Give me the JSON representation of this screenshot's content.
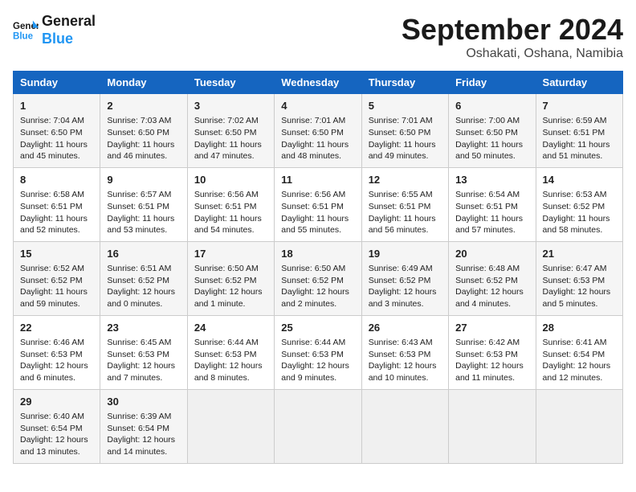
{
  "header": {
    "logo_line1": "General",
    "logo_line2": "Blue",
    "month": "September 2024",
    "location": "Oshakati, Oshana, Namibia"
  },
  "weekdays": [
    "Sunday",
    "Monday",
    "Tuesday",
    "Wednesday",
    "Thursday",
    "Friday",
    "Saturday"
  ],
  "weeks": [
    [
      {
        "day": "1",
        "sunrise": "Sunrise: 7:04 AM",
        "sunset": "Sunset: 6:50 PM",
        "daylight": "Daylight: 11 hours and 45 minutes."
      },
      {
        "day": "2",
        "sunrise": "Sunrise: 7:03 AM",
        "sunset": "Sunset: 6:50 PM",
        "daylight": "Daylight: 11 hours and 46 minutes."
      },
      {
        "day": "3",
        "sunrise": "Sunrise: 7:02 AM",
        "sunset": "Sunset: 6:50 PM",
        "daylight": "Daylight: 11 hours and 47 minutes."
      },
      {
        "day": "4",
        "sunrise": "Sunrise: 7:01 AM",
        "sunset": "Sunset: 6:50 PM",
        "daylight": "Daylight: 11 hours and 48 minutes."
      },
      {
        "day": "5",
        "sunrise": "Sunrise: 7:01 AM",
        "sunset": "Sunset: 6:50 PM",
        "daylight": "Daylight: 11 hours and 49 minutes."
      },
      {
        "day": "6",
        "sunrise": "Sunrise: 7:00 AM",
        "sunset": "Sunset: 6:50 PM",
        "daylight": "Daylight: 11 hours and 50 minutes."
      },
      {
        "day": "7",
        "sunrise": "Sunrise: 6:59 AM",
        "sunset": "Sunset: 6:51 PM",
        "daylight": "Daylight: 11 hours and 51 minutes."
      }
    ],
    [
      {
        "day": "8",
        "sunrise": "Sunrise: 6:58 AM",
        "sunset": "Sunset: 6:51 PM",
        "daylight": "Daylight: 11 hours and 52 minutes."
      },
      {
        "day": "9",
        "sunrise": "Sunrise: 6:57 AM",
        "sunset": "Sunset: 6:51 PM",
        "daylight": "Daylight: 11 hours and 53 minutes."
      },
      {
        "day": "10",
        "sunrise": "Sunrise: 6:56 AM",
        "sunset": "Sunset: 6:51 PM",
        "daylight": "Daylight: 11 hours and 54 minutes."
      },
      {
        "day": "11",
        "sunrise": "Sunrise: 6:56 AM",
        "sunset": "Sunset: 6:51 PM",
        "daylight": "Daylight: 11 hours and 55 minutes."
      },
      {
        "day": "12",
        "sunrise": "Sunrise: 6:55 AM",
        "sunset": "Sunset: 6:51 PM",
        "daylight": "Daylight: 11 hours and 56 minutes."
      },
      {
        "day": "13",
        "sunrise": "Sunrise: 6:54 AM",
        "sunset": "Sunset: 6:51 PM",
        "daylight": "Daylight: 11 hours and 57 minutes."
      },
      {
        "day": "14",
        "sunrise": "Sunrise: 6:53 AM",
        "sunset": "Sunset: 6:52 PM",
        "daylight": "Daylight: 11 hours and 58 minutes."
      }
    ],
    [
      {
        "day": "15",
        "sunrise": "Sunrise: 6:52 AM",
        "sunset": "Sunset: 6:52 PM",
        "daylight": "Daylight: 11 hours and 59 minutes."
      },
      {
        "day": "16",
        "sunrise": "Sunrise: 6:51 AM",
        "sunset": "Sunset: 6:52 PM",
        "daylight": "Daylight: 12 hours and 0 minutes."
      },
      {
        "day": "17",
        "sunrise": "Sunrise: 6:50 AM",
        "sunset": "Sunset: 6:52 PM",
        "daylight": "Daylight: 12 hours and 1 minute."
      },
      {
        "day": "18",
        "sunrise": "Sunrise: 6:50 AM",
        "sunset": "Sunset: 6:52 PM",
        "daylight": "Daylight: 12 hours and 2 minutes."
      },
      {
        "day": "19",
        "sunrise": "Sunrise: 6:49 AM",
        "sunset": "Sunset: 6:52 PM",
        "daylight": "Daylight: 12 hours and 3 minutes."
      },
      {
        "day": "20",
        "sunrise": "Sunrise: 6:48 AM",
        "sunset": "Sunset: 6:52 PM",
        "daylight": "Daylight: 12 hours and 4 minutes."
      },
      {
        "day": "21",
        "sunrise": "Sunrise: 6:47 AM",
        "sunset": "Sunset: 6:53 PM",
        "daylight": "Daylight: 12 hours and 5 minutes."
      }
    ],
    [
      {
        "day": "22",
        "sunrise": "Sunrise: 6:46 AM",
        "sunset": "Sunset: 6:53 PM",
        "daylight": "Daylight: 12 hours and 6 minutes."
      },
      {
        "day": "23",
        "sunrise": "Sunrise: 6:45 AM",
        "sunset": "Sunset: 6:53 PM",
        "daylight": "Daylight: 12 hours and 7 minutes."
      },
      {
        "day": "24",
        "sunrise": "Sunrise: 6:44 AM",
        "sunset": "Sunset: 6:53 PM",
        "daylight": "Daylight: 12 hours and 8 minutes."
      },
      {
        "day": "25",
        "sunrise": "Sunrise: 6:44 AM",
        "sunset": "Sunset: 6:53 PM",
        "daylight": "Daylight: 12 hours and 9 minutes."
      },
      {
        "day": "26",
        "sunrise": "Sunrise: 6:43 AM",
        "sunset": "Sunset: 6:53 PM",
        "daylight": "Daylight: 12 hours and 10 minutes."
      },
      {
        "day": "27",
        "sunrise": "Sunrise: 6:42 AM",
        "sunset": "Sunset: 6:53 PM",
        "daylight": "Daylight: 12 hours and 11 minutes."
      },
      {
        "day": "28",
        "sunrise": "Sunrise: 6:41 AM",
        "sunset": "Sunset: 6:54 PM",
        "daylight": "Daylight: 12 hours and 12 minutes."
      }
    ],
    [
      {
        "day": "29",
        "sunrise": "Sunrise: 6:40 AM",
        "sunset": "Sunset: 6:54 PM",
        "daylight": "Daylight: 12 hours and 13 minutes."
      },
      {
        "day": "30",
        "sunrise": "Sunrise: 6:39 AM",
        "sunset": "Sunset: 6:54 PM",
        "daylight": "Daylight: 12 hours and 14 minutes."
      },
      null,
      null,
      null,
      null,
      null
    ]
  ]
}
